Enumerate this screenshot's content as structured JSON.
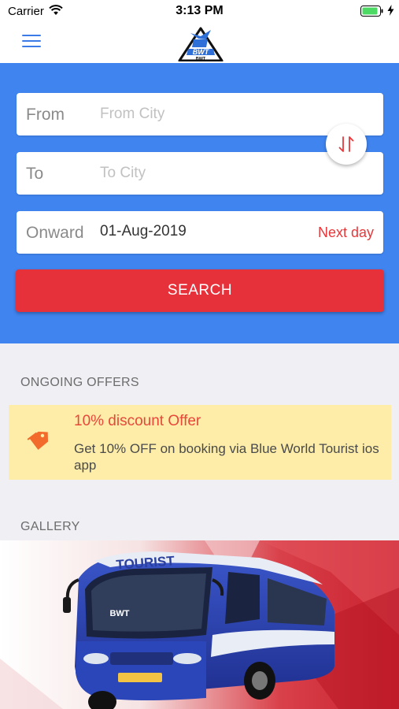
{
  "status_bar": {
    "carrier": "Carrier",
    "time": "3:13 PM",
    "icons": [
      "wifi-icon",
      "battery-icon",
      "charging-bolt-icon"
    ]
  },
  "nav": {
    "menu_icon": "hamburger-menu-icon",
    "logo_text": "BWT"
  },
  "search_form": {
    "from": {
      "label": "From",
      "placeholder": "From City",
      "value": ""
    },
    "to": {
      "label": "To",
      "placeholder": "To City",
      "value": ""
    },
    "swap_icon": "swap-arrows-icon",
    "onward": {
      "label": "Onward",
      "value": "01-Aug-2019",
      "next_day": "Next day"
    },
    "search_button": "SEARCH"
  },
  "offers": {
    "heading": "ONGOING OFFERS",
    "items": [
      {
        "icon": "price-tag-icon",
        "title": "10% discount Offer",
        "description": "Get 10% OFF on booking via Blue World Tourist ios app"
      }
    ]
  },
  "gallery": {
    "heading": "GALLERY",
    "bus_text": "TOURIST",
    "bus_brand": "BWT"
  },
  "colors": {
    "primary_blue": "#4084ef",
    "search_red": "#e7313a",
    "offer_background": "#fdeda9",
    "offer_title": "#e8473a"
  }
}
